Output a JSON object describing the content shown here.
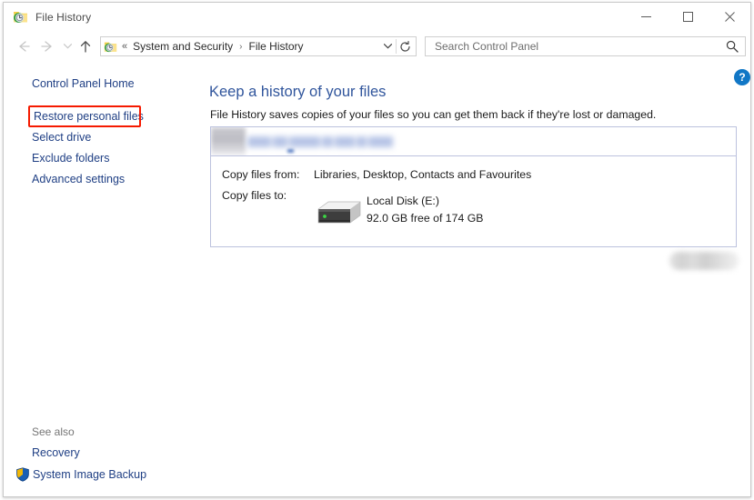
{
  "window": {
    "title": "File History",
    "icon": "file-history-icon",
    "controls": {
      "minimize": "─",
      "maximize": "□",
      "close": "✕"
    }
  },
  "navbar": {
    "back": "←",
    "forward": "→",
    "recent": "⌄",
    "up": "↑",
    "breadcrumb": {
      "chevrons": "«",
      "items": [
        "System and Security",
        "File History"
      ],
      "separator": "›"
    },
    "dropdown": "⌄",
    "refresh": "↻"
  },
  "search": {
    "placeholder": "Search Control Panel",
    "value": "",
    "icon": "search-icon"
  },
  "sidebar": {
    "items": [
      {
        "label": "Control Panel Home",
        "highlighted": false
      },
      {
        "label": "Restore personal files",
        "highlighted": true
      },
      {
        "label": "Select drive",
        "highlighted": false
      },
      {
        "label": "Exclude folders",
        "highlighted": false
      },
      {
        "label": "Advanced settings",
        "highlighted": false
      }
    ],
    "see_also": {
      "label": "See also",
      "items": [
        {
          "label": "Recovery",
          "icon": null
        },
        {
          "label": "System Image Backup",
          "icon": "uac-shield-icon"
        }
      ]
    }
  },
  "main": {
    "heading": "Keep a history of your files",
    "description": "File History saves copies of your files so you can get them back if they're lost or damaged.",
    "status_row": {
      "redacted": true,
      "label": ""
    },
    "copy_from": {
      "label": "Copy files from:",
      "value": "Libraries, Desktop, Contacts and Favourites"
    },
    "copy_to": {
      "label": "Copy files to:",
      "drive_icon": "external-hard-drive-icon",
      "drive_name": "Local Disk (E:)",
      "drive_capacity": "92.0 GB free of 174 GB"
    },
    "action_button": {
      "redacted": true,
      "label": ""
    },
    "help": {
      "label": "?",
      "icon": "help-question-icon"
    }
  },
  "colors": {
    "link": "#1f3f84",
    "heading": "#30559c",
    "highlight_box": "#f51a00",
    "panel_border": "#bcc2de",
    "help_blue": "#1177c6"
  }
}
